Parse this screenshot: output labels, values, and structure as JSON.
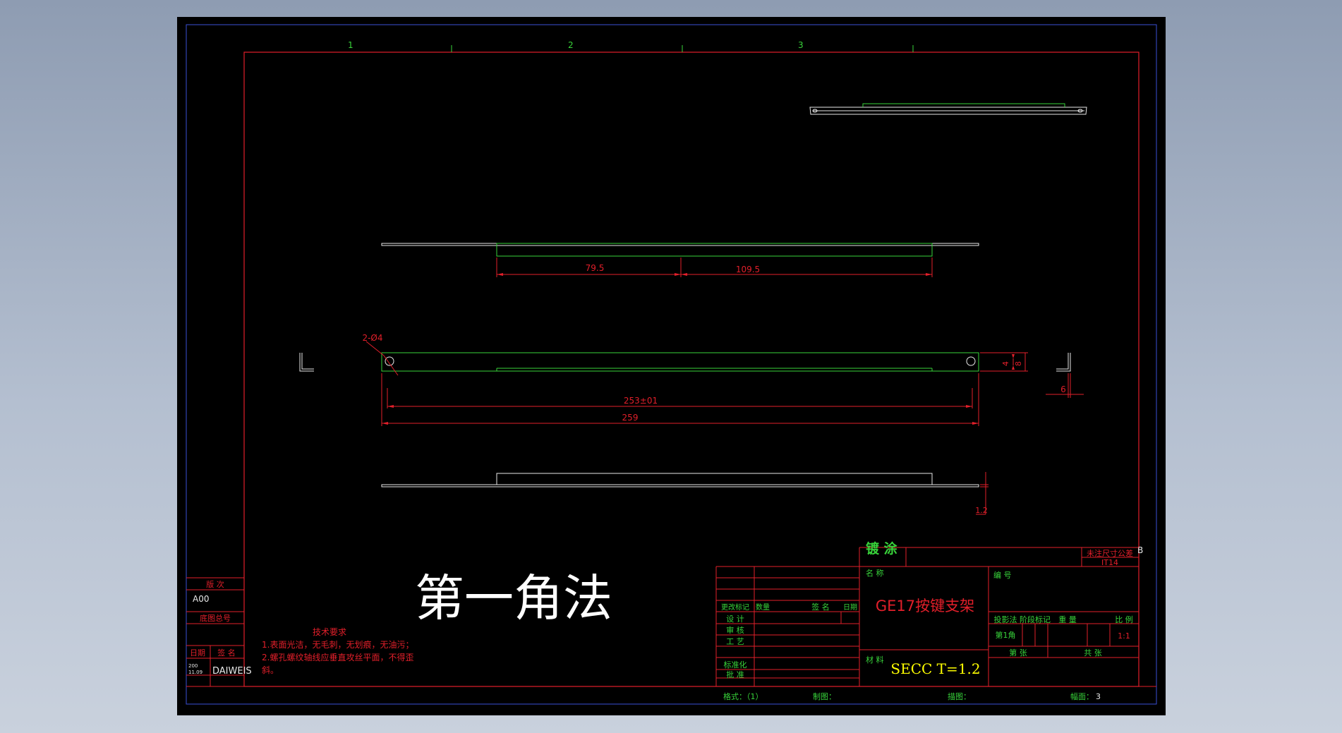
{
  "zones": [
    "1",
    "2",
    "3"
  ],
  "zone_b": "B",
  "dims": {
    "d79": "79.5",
    "d109": "109.5",
    "holes": "2-Ø4",
    "d253": "253±01",
    "d259": "259",
    "d4": "4",
    "d8": "8",
    "d6": "6",
    "d12": "1.2"
  },
  "projection_label": "第一角法",
  "tech_req": {
    "title": "技术要求",
    "line1": "1.表面光洁，无毛刺，无划痕，无油污；",
    "line2": "2.螺孔螺纹轴线应垂直攻丝平面，不得歪",
    "line3": "斜。"
  },
  "side_block": {
    "version_label": "版 次",
    "version_value": "A00",
    "old_no_label": "底图总号",
    "date_label": "日期",
    "sign_label": "签 名",
    "date_value_line1": "200",
    "date_value_line2": "11.09",
    "signer": "DAIWEIS"
  },
  "title_block": {
    "plating_label": "镀 涂",
    "tolerance_label": "未注尺寸公差",
    "tolerance_value": "IT14",
    "name_label": "名 称",
    "part_name": "GE17按键支架",
    "number_label": "编 号",
    "projection_method_label": "投影法",
    "stage_label": "阶段标记",
    "weight_label": "重 量",
    "scale_label": "比 例",
    "first_angle": "第1角",
    "scale_value": "1:1",
    "material_label": "材 料",
    "material_value": "SECC T=1.2",
    "sheet_label": "第 张",
    "total_label": "共 张",
    "change_mark": "更改标记",
    "quantity": "数量",
    "sign_col": "签 名",
    "date_col": "日期",
    "design": "设 计",
    "check": "审 核",
    "process": "工 艺",
    "standard": "标准化",
    "approve": "批 准"
  },
  "bottom_bar": {
    "format": "格式：（1）",
    "drawn": "制图：",
    "traced": "描图：",
    "sheet_size_label": "幅面：",
    "sheet_size_value": "3"
  }
}
